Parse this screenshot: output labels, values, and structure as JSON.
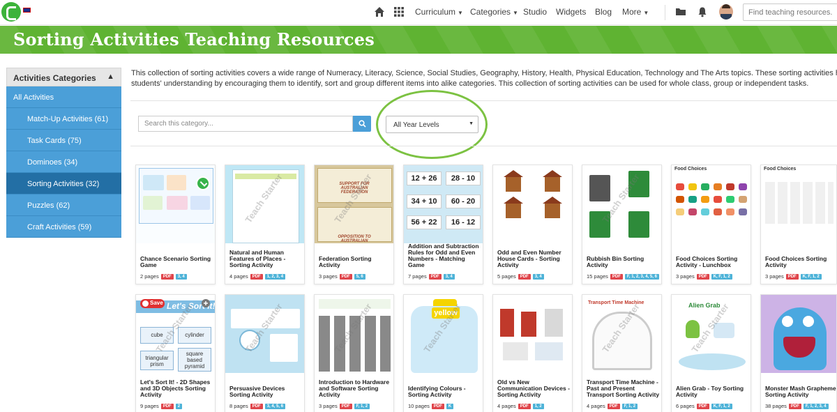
{
  "nav": {
    "links": [
      "Curriculum",
      "Categories",
      "Studio",
      "Widgets",
      "Blog",
      "More"
    ],
    "search_placeholder": "Find teaching resources..."
  },
  "page": {
    "title": "Sorting Activities Teaching Resources",
    "description_line1": "This collection of sorting activities covers a wide range of Numeracy, Literacy, Science, Social Studies, Geography, History, Health, Physical Education, Technology and The Arts topics. These sorting activities help consoli",
    "description_line2": "students' understanding by encouraging them to identify, sort and group different items into alike categories. This collection of sorting activities can be used for whole class, group or independent tasks."
  },
  "sidebar": {
    "heading": "Activities Categories",
    "items": [
      {
        "label": "All Activities"
      },
      {
        "label": "Match-Up Activities (61)"
      },
      {
        "label": "Task Cards (75)"
      },
      {
        "label": "Dominoes (34)"
      },
      {
        "label": "Sorting Activities (32)"
      },
      {
        "label": "Puzzles (62)"
      },
      {
        "label": "Craft Activities (59)"
      }
    ]
  },
  "filters": {
    "search_placeholder": "Search this category...",
    "year_select": "All Year Levels"
  },
  "badges": {
    "pdf": "PDF",
    "save": "Save"
  },
  "cards": [
    {
      "title": "Chance Scenario Sorting Game",
      "pages": "2 pages",
      "years": "3, 4"
    },
    {
      "title": "Natural and Human Features of Places - Sorting Activity",
      "pages": "4 pages",
      "years": "1, 2, 3, 4"
    },
    {
      "title": "Federation Sorting Activity",
      "pages": "3 pages",
      "years": "5, 6"
    },
    {
      "title": "Addition and Subtraction Rules for Odd and Even Numbers - Matching Game",
      "pages": "7 pages",
      "years": "3, 4"
    },
    {
      "title": "Odd and Even Number House Cards - Sorting Activity",
      "pages": "5 pages",
      "years": "3, 4"
    },
    {
      "title": "Rubbish Bin Sorting Activity",
      "pages": "15 pages",
      "years": "F, 1, 2, 3, 4, 5, 6"
    },
    {
      "title": "Food Choices Sorting Activity - Lunchbox",
      "pages": "3 pages",
      "years": "K, F, 1, 2"
    },
    {
      "title": "Food Choices Sorting Activity",
      "pages": "3 pages",
      "years": "K, F, 1, 2"
    },
    {
      "title": "Let's Sort It! - 2D Shapes and 3D Objects Sorting Activity",
      "pages": "9 pages",
      "years": "2"
    },
    {
      "title": "Persuasive Devices Sorting Activity",
      "pages": "8 pages",
      "years": "3, 4, 5, 6"
    },
    {
      "title": "Introduction to Hardware and Software Sorting Activity",
      "pages": "3 pages",
      "years": "F, 1, 2"
    },
    {
      "title": "Identifying Colours - Sorting Activity",
      "pages": "10 pages",
      "years": "K"
    },
    {
      "title": "Old vs New Communication Devices - Sorting Activity",
      "pages": "4 pages",
      "years": "1, 2"
    },
    {
      "title": "Transport Time Machine - Past and Present Transport Sorting Activity",
      "pages": "4 pages",
      "years": "F, 1, 2"
    },
    {
      "title": "Alien Grab - Toy Sorting Activity",
      "pages": "6 pages",
      "years": "K, F, 1, 2"
    },
    {
      "title": "Monster Mash Grapheme Sorting Activity",
      "pages": "38 pages",
      "years": "F, 1, 2, 3, 4"
    }
  ],
  "thumb_text": {
    "watermark": "Teach Starter",
    "sort_title": "Let's Sort It!",
    "shapes": [
      "cube",
      "cylinder",
      "triangular prism",
      "square based pyramid"
    ],
    "jar_label": "yellow",
    "math": [
      "12 + 26",
      "28 - 10",
      "34 + 10",
      "60 - 20",
      "56 + 22",
      "16 - 12"
    ],
    "federation_top": "SUPPORT FOR AUSTRALIAN FEDERATION",
    "federation_bottom": "OPPOSITION TO AUSTRALIAN",
    "food_heading": "Food Choices",
    "alien_heading": "Alien Grab",
    "transport_heading": "Transport Time Machine"
  }
}
